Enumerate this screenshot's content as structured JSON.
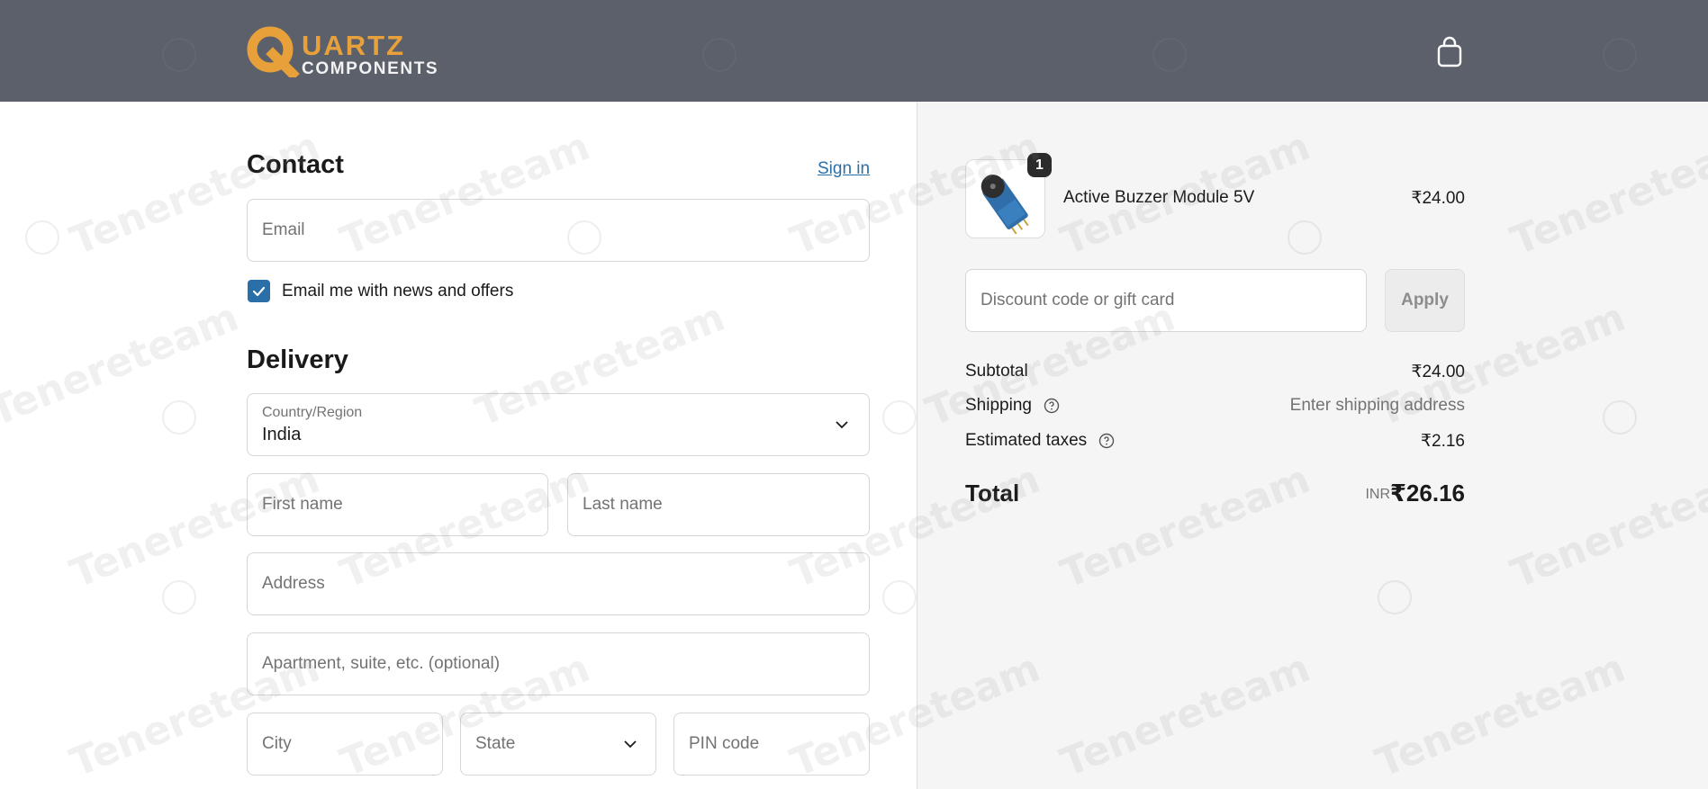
{
  "header": {
    "logo_quartz": "UARTZ",
    "logo_components": "COMPONENTS",
    "cart_icon": "shopping-bag-icon"
  },
  "contact": {
    "title": "Contact",
    "signin_label": "Sign in",
    "email_placeholder": "Email",
    "news_checkbox_checked": true,
    "news_label": "Email me with news and offers"
  },
  "delivery": {
    "title": "Delivery",
    "country_label": "Country/Region",
    "country_value": "India",
    "first_name_placeholder": "First name",
    "last_name_placeholder": "Last name",
    "address_placeholder": "Address",
    "apartment_placeholder": "Apartment, suite, etc. (optional)",
    "city_placeholder": "City",
    "state_placeholder": "State",
    "pin_placeholder": "PIN code"
  },
  "summary": {
    "item": {
      "quantity": "1",
      "name": "Active Buzzer Module 5V",
      "price": "₹24.00"
    },
    "discount_placeholder": "Discount code or gift card",
    "apply_label": "Apply",
    "subtotal_label": "Subtotal",
    "subtotal_value": "₹24.00",
    "shipping_label": "Shipping",
    "shipping_value": "Enter shipping address",
    "taxes_label": "Estimated taxes",
    "taxes_value": "₹2.16",
    "total_label": "Total",
    "total_currency": "INR",
    "total_value": "₹26.16"
  },
  "colors": {
    "header_bg": "#5b606b",
    "brand_orange": "#e8a03a",
    "link_blue": "#2a6fa8",
    "summary_bg": "#f5f5f5"
  },
  "watermark_text": "Tenereteam"
}
